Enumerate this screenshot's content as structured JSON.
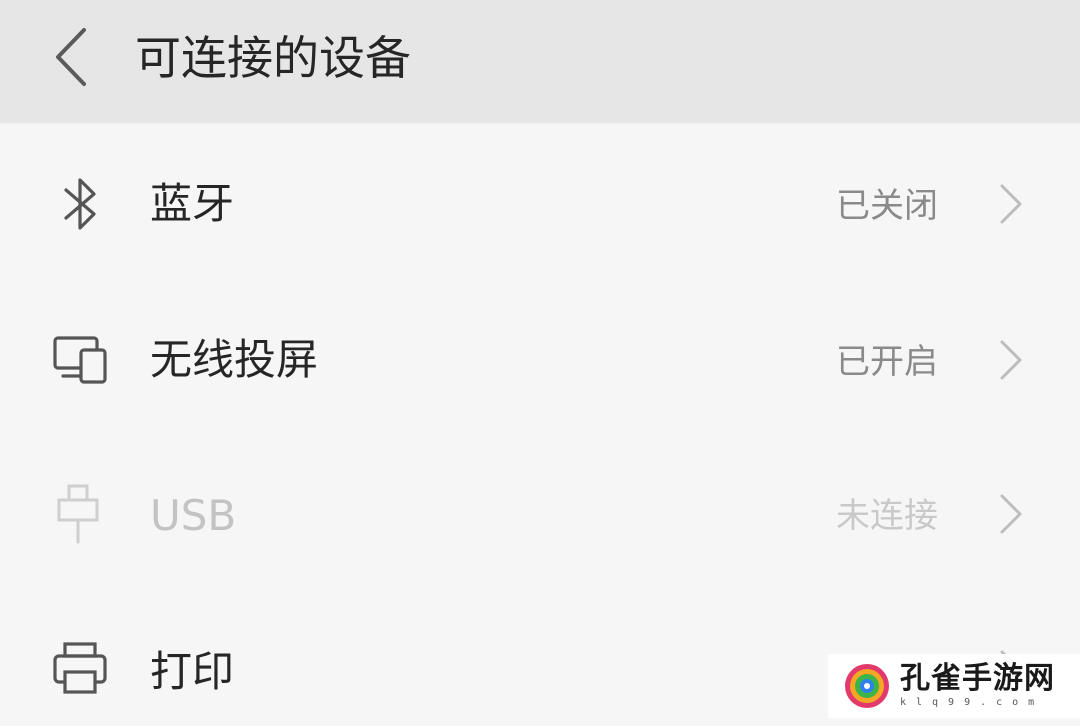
{
  "header": {
    "title": "可连接的设备",
    "back_icon": "chevron-left-icon"
  },
  "rows": [
    {
      "icon": "bluetooth-icon",
      "label": "蓝牙",
      "status": "已关闭",
      "enabled": true
    },
    {
      "icon": "wireless-display-icon",
      "label": "无线投屏",
      "status": "已开启",
      "enabled": true
    },
    {
      "icon": "usb-icon",
      "label": "USB",
      "status": "未连接",
      "enabled": false
    },
    {
      "icon": "printer-icon",
      "label": "打印",
      "status": "",
      "enabled": true
    }
  ],
  "watermark": {
    "name": "孔雀手游网",
    "url": "klq99.com"
  },
  "colors": {
    "header_bg": "#e6e6e6",
    "page_bg": "#f6f6f6",
    "text_primary": "#262626",
    "text_secondary": "#8a8a8a",
    "text_disabled": "#c3c3c3"
  }
}
